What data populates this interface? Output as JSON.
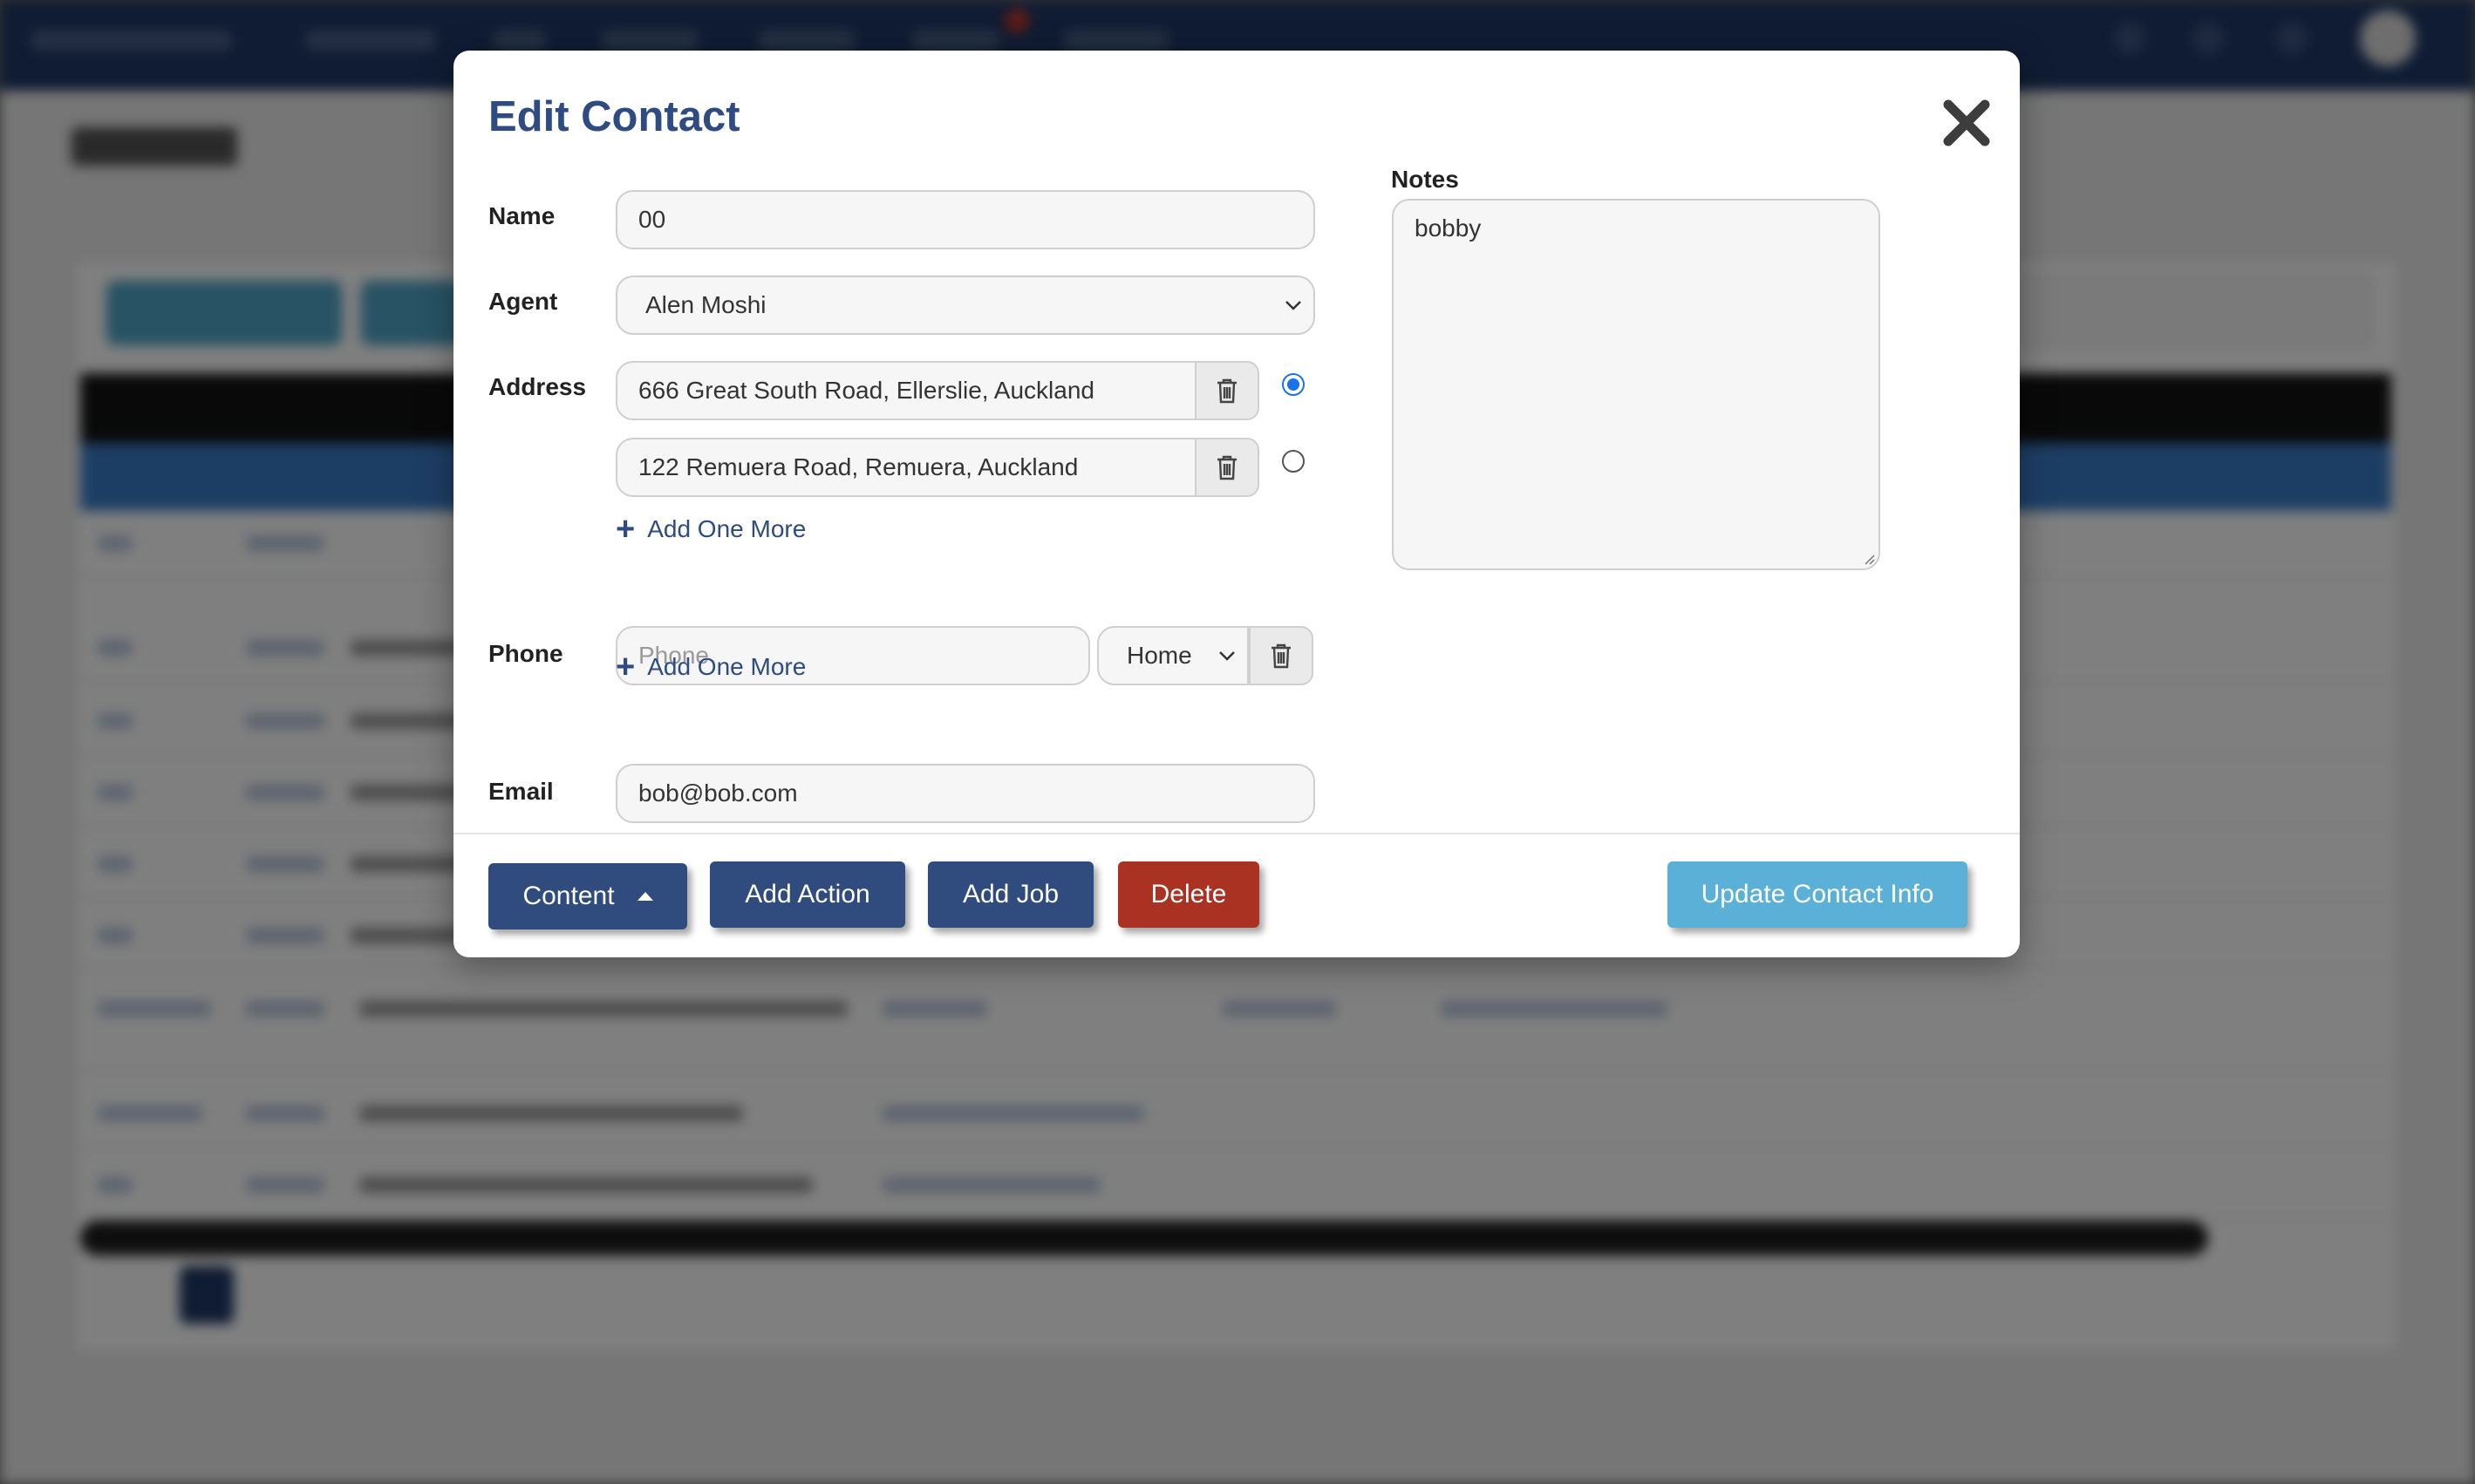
{
  "modal": {
    "title": "Edit Contact"
  },
  "form": {
    "name_label": "Name",
    "name_value": "00",
    "agent_label": "Agent",
    "agent_value": "Alen Moshi",
    "address_label": "Address",
    "addresses": [
      {
        "value": "666 Great South Road, Ellerslie, Auckland",
        "primary": true
      },
      {
        "value": "122 Remuera Road, Remuera, Auckland",
        "primary": false
      }
    ],
    "add_one_more": "Add One More",
    "phone_label": "Phone",
    "phone_placeholder": "Phone",
    "phone_type": "Home",
    "email_label": "Email",
    "email_value": "bob@bob.com"
  },
  "notes": {
    "label": "Notes",
    "value": "bobby"
  },
  "footer": {
    "content_label": "Content",
    "add_action_label": "Add Action",
    "add_job_label": "Add Job",
    "delete_label": "Delete",
    "update_label": "Update Contact Info"
  },
  "colors": {
    "title": "#2e4b82",
    "navy_button": "#304b7e",
    "delete_button": "#a93222",
    "update_button": "#5ab0d7",
    "overlay": "rgba(0,0,0,0.5)"
  },
  "icons": {
    "close": "close-icon",
    "delete_row": "trash-icon",
    "add": "plus-icon",
    "select": "chevron-down-icon",
    "dropdown": "caret-up-icon"
  }
}
